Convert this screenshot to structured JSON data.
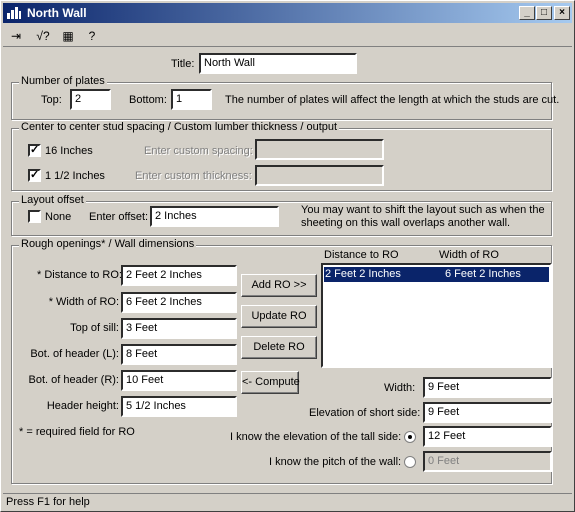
{
  "window": {
    "title": "North Wall",
    "controls": {
      "minimize": "_",
      "maximize": "□",
      "close": "×"
    }
  },
  "toolbar": {
    "icons": [
      "exit-icon",
      "calculate-icon",
      "settings-icon",
      "help-icon"
    ],
    "glyphs": {
      "exit": "⇥",
      "calc": "√?",
      "settings": "▦",
      "help": "?"
    }
  },
  "title_field": {
    "label": "Title:",
    "value": "North Wall"
  },
  "plates": {
    "group": "Number of plates",
    "top_label": "Top:",
    "top_value": "2",
    "bottom_label": "Bottom:",
    "bottom_value": "1",
    "note": "The number of plates will affect the length at which the studs are cut."
  },
  "spacing": {
    "group": "Center to center stud spacing / Custom lumber thickness / output",
    "opt1_label": "16 Inches",
    "opt1_checked": true,
    "custom_spacing_label": "Enter custom spacing:",
    "custom_spacing_value": "",
    "opt2_label": "1 1/2 Inches",
    "opt2_checked": true,
    "custom_thickness_label": "Enter custom thickness:",
    "custom_thickness_value": ""
  },
  "layout": {
    "group": "Layout offset",
    "none_label": "None",
    "none_checked": false,
    "offset_label": "Enter offset:",
    "offset_value": "2 Inches",
    "note_line1": "You may want to shift the layout such as when the",
    "note_line2": "sheeting on this wall overlaps another wall."
  },
  "ro": {
    "group": "Rough openings* / Wall dimensions",
    "distance_label": "* Distance to RO:",
    "distance_value": "2 Feet 2 Inches",
    "width_label": "* Width of RO:",
    "width_value": "6 Feet 2 Inches",
    "sill_label": "Top of sill:",
    "sill_value": "3 Feet",
    "headerL_label": "Bot. of header (L):",
    "headerL_value": "8 Feet",
    "headerR_label": "Bot. of header (R):",
    "headerR_value": "10 Feet",
    "header_height_label": "Header height:",
    "header_height_value": "5 1/2 Inches",
    "required_note": "* = required field for RO",
    "add_btn": "Add RO >>",
    "update_btn": "Update RO",
    "delete_btn": "Delete RO",
    "compute_btn": "<- Compute",
    "list_headers": [
      "Distance to RO",
      "Width of RO"
    ],
    "list_rows": [
      {
        "distance": "2 Feet 2 Inches",
        "width": "6 Feet 2 Inches",
        "selected": true
      }
    ],
    "wall_width_label": "Width:",
    "wall_width_value": "9 Feet",
    "short_side_label": "Elevation of short side:",
    "short_side_value": "9 Feet",
    "tall_side_label": "I know the elevation of the tall side:",
    "tall_side_value": "12 Feet",
    "tall_selected": true,
    "pitch_label": "I know the pitch of the wall:",
    "pitch_value": "0 Feet",
    "pitch_selected": false
  },
  "status": {
    "text": "Press F1 for help"
  }
}
